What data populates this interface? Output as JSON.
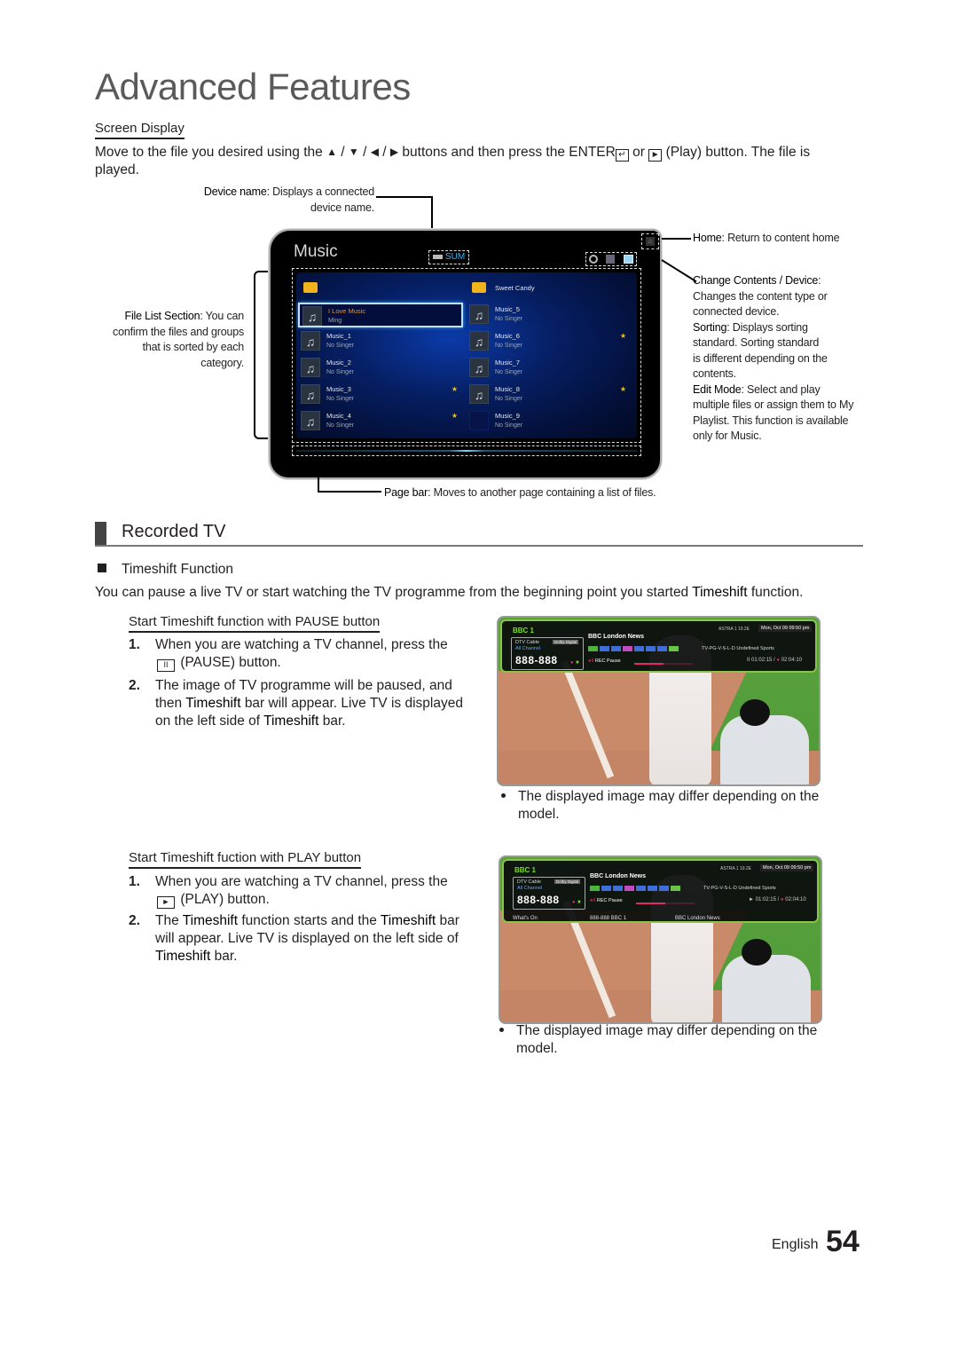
{
  "page": {
    "title": "Advanced Features",
    "footer": {
      "language": "English",
      "page_number": "54"
    }
  },
  "screen_display": {
    "heading": "Screen Display",
    "intro_before": "Move to the file you desired using the",
    "arrows": [
      "▲",
      "▼",
      "◀",
      "▶"
    ],
    "intro_mid": "buttons and then press the",
    "enter_label": "ENTER",
    "enter_icon": "↵",
    "or": "or",
    "play_icon": "►",
    "intro_after": "(Play) button. The file is",
    "intro_line2": "played.",
    "callouts": {
      "device_name": {
        "term": "Device name",
        "text": ": Displays a connected",
        "text2": "device name."
      },
      "file_list": {
        "term": "File List Section",
        "text": ": You can",
        "line2": "confirm the files and groups",
        "line3": "that is sorted by each",
        "line4": "category."
      },
      "home": {
        "term": "Home",
        "text": ": Return to content home"
      },
      "change_contents": {
        "term": "Change Contents / Device",
        "text": ":",
        "line2": "Changes the content type or",
        "line3": "connected device."
      },
      "sorting": {
        "term": "Sorting",
        "text": ": Displays sorting",
        "line2": "standard. Sorting standard",
        "line3": "is different depending on the",
        "line4": "contents."
      },
      "edit_mode": {
        "term": "Edit Mode",
        "text": ": Select and play",
        "line2": "multiple files or assign them to My",
        "line3": "Playlist. This function is available",
        "line4": "only for Music."
      },
      "page_bar": {
        "term": "Page bar",
        "text": ": Moves to another page containing a list of files."
      }
    },
    "tv_screen": {
      "title": "Music",
      "device": "SUM",
      "home_icon": "⌂",
      "tools": [
        "sort-icon",
        "edit-mode-icon",
        "change-contents-icon"
      ],
      "left_column": [
        {
          "type": "folder",
          "title": "",
          "subtitle": "",
          "starred": false
        },
        {
          "type": "music",
          "title": "I Love Music",
          "subtitle": "Ming",
          "starred": false,
          "selected": true
        },
        {
          "type": "music",
          "title": "Music_1",
          "subtitle": "No Singer",
          "starred": false
        },
        {
          "type": "music",
          "title": "Music_2",
          "subtitle": "No Singer",
          "starred": false
        },
        {
          "type": "music",
          "title": "Music_3",
          "subtitle": "No Singer",
          "starred": true
        },
        {
          "type": "music",
          "title": "Music_4",
          "subtitle": "No Singer",
          "starred": true
        }
      ],
      "right_column": [
        {
          "type": "folder",
          "title": "Sweet Candy",
          "subtitle": "",
          "starred": false
        },
        {
          "type": "music",
          "title": "Music_5",
          "subtitle": "No Singer",
          "starred": false
        },
        {
          "type": "music",
          "title": "Music_6",
          "subtitle": "No Singer",
          "starred": true
        },
        {
          "type": "music",
          "title": "Music_7",
          "subtitle": "No Singer",
          "starred": false
        },
        {
          "type": "music",
          "title": "Music_8",
          "subtitle": "No Singer",
          "starred": true
        },
        {
          "type": "blank",
          "title": "Music_9",
          "subtitle": "No Singer",
          "starred": false
        }
      ],
      "colors": {
        "selected_title": "#ff9000",
        "device": "#36b6ff",
        "star": "#f2c200"
      }
    }
  },
  "recorded_tv": {
    "heading": "Recorded TV",
    "timeshift": {
      "heading": "Timeshift Function",
      "intro_before": "You can pause a live TV or start watching the TV programme from the beginning point you started",
      "intro_bold": "Timeshift",
      "intro_after": "function."
    },
    "pause_section": {
      "heading": "Start Timeshift function with PAUSE button",
      "step1_num": "1.",
      "step1_line1": "When you are watching a TV channel, press the",
      "step1_icon": "II",
      "step1_line2": "(PAUSE) button.",
      "step2_num": "2.",
      "step2_a": "The image of TV programme will be paused, and",
      "step2_b1": "then",
      "step2_b_bold": "Timeshift",
      "step2_b2": "bar will appear. Live TV is displayed",
      "step2_c1": "on the left side of",
      "step2_c_bold": "Timeshift",
      "step2_c2": "bar.",
      "note": "The displayed image may differ depending on the",
      "note2": "model."
    },
    "play_section": {
      "heading": "Start Timeshift fuction with PLAY button",
      "step1_num": "1.",
      "step1_line1": "When you are watching a TV channel, press the",
      "step1_icon": "►",
      "step1_line2": "(PLAY) button.",
      "step2_num": "2.",
      "step2_a1": "The",
      "step2_a_bold1": "Timeshift",
      "step2_a2": "function starts and the",
      "step2_a_bold2": "Timeshift",
      "step2_a3": "bar",
      "step2_b": "will appear. Live TV is displayed on the left side of",
      "step2_c_bold": "Timeshift",
      "step2_c": "bar.",
      "note": "The displayed image may differ depending on the",
      "note2": "model."
    },
    "osd_pause": {
      "channel_name": "BBC 1",
      "source": "DTV Cable",
      "list": "All Channel",
      "audio": "Dolby Digital",
      "channel_number": "888-888",
      "programme": "BBC London News",
      "satellite": "ASTRA 1 19.2E",
      "datetime": "Mon, Oct 09  09:50 pm",
      "rating_info": "TV-PG-V-S-L-D   Undefined   Sports",
      "status": "REC Pause",
      "mode_icon": "II",
      "time_current": "01:02:15",
      "time_total": "02:04:10",
      "progress": 0.5
    },
    "osd_play": {
      "channel_name": "BBC 1",
      "source": "DTV Cable",
      "list": "All Channel",
      "audio": "Dolby Digital",
      "channel_number": "888-888",
      "programme": "BBC London News",
      "satellite": "ASTRA 1 19.2E",
      "datetime": "Mon, Oct 09  09:50 pm",
      "rating_info": "TV-PG-V-S-L-D   Undefined   Sports",
      "status": "REC Pause",
      "mode_icon": "►",
      "time_current": "01:02:15",
      "time_total": "02:04:10",
      "progress": 0.5,
      "whats_on": "What's On",
      "whats_on_channel": "888-888    BBC 1",
      "whats_on_programme": "BBC London News"
    }
  }
}
